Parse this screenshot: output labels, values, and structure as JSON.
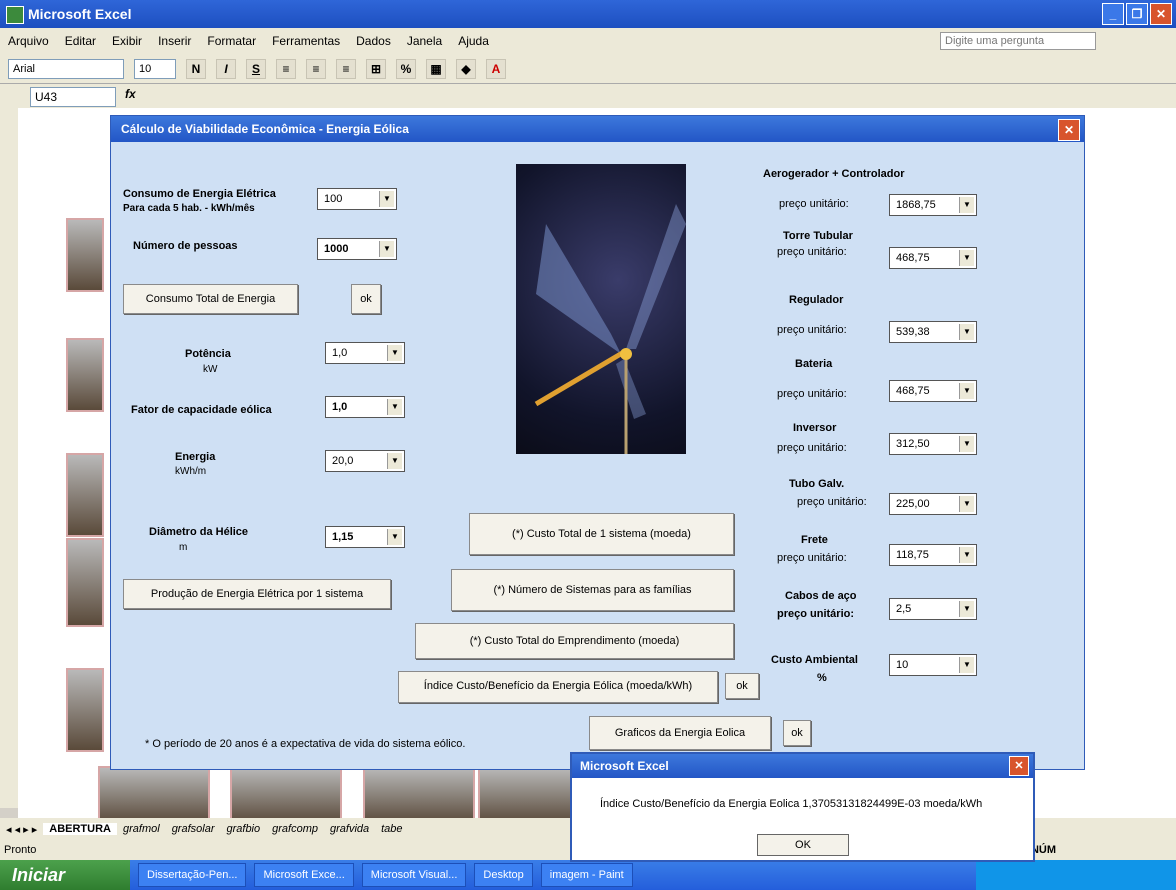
{
  "excel": {
    "title": "Microsoft Excel",
    "menu": [
      "Arquivo",
      "Editar",
      "Exibir",
      "Inserir",
      "Formatar",
      "Ferramentas",
      "Dados",
      "Janela",
      "Ajuda"
    ],
    "help_placeholder": "Digite uma pergunta",
    "font_name": "Arial",
    "font_size": "10",
    "name_box": "U43",
    "fx": "fx",
    "sheet_tabs": [
      "ABERTURA",
      "grafmol",
      "grafsolar",
      "grafbio",
      "grafcomp",
      "grafvida",
      "tabe"
    ],
    "status_left": "Pronto",
    "status_num": "NÚM"
  },
  "dialog": {
    "title": "Cálculo de Viabilidade Econômica - Energia Eólica",
    "consumo_label": "Consumo de Energia Elétrica",
    "consumo_sub": "Para cada 5 hab. -  kWh/mês",
    "consumo_value": "100",
    "pessoas_label": "Número de pessoas",
    "pessoas_value": "1000",
    "consumo_total_btn": "Consumo Total de Energia",
    "ok": "ok",
    "potencia_label": "Potência",
    "potencia_unit": "kW",
    "potencia_value": "1,0",
    "fator_label": "Fator de capacidade eólica",
    "fator_value": "1,0",
    "energia_label": "Energia",
    "energia_unit": "kWh/m",
    "energia_value": "20,0",
    "diametro_label": "Diâmetro da Hélice",
    "diametro_unit": "m",
    "diametro_value": "1,15",
    "producao_btn": "Produção de Energia Elétrica por 1 sistema",
    "custo_sistema_btn": "(*) Custo Total de 1 sistema (moeda)",
    "num_sistemas_btn": "(*) Número de Sistemas para as famílias",
    "custo_empreend_btn": "(*) Custo Total do Emprendimento (moeda)",
    "indice_btn": "Índice Custo/Benefício da Energia Eólica (moeda/kWh)",
    "graficos_btn": "Graficos da Energia Eolica",
    "footnote": "*  O período de 20 anos é a expectativa de vida do sistema eólico.",
    "preco_unitario": "preço unitário:",
    "right": [
      {
        "title": "Aerogerador + Controlador",
        "value": "1868,75"
      },
      {
        "title": "Torre Tubular",
        "value": "468,75"
      },
      {
        "title": "Regulador",
        "value": "539,38"
      },
      {
        "title": "Bateria",
        "value": "468,75"
      },
      {
        "title": "Inversor",
        "value": "312,50"
      },
      {
        "title": "Tubo Galv.",
        "value": "225,00"
      },
      {
        "title": "Frete",
        "value": "118,75"
      },
      {
        "title": "Cabos de aço",
        "value": "2,5"
      },
      {
        "title": "Custo Ambiental",
        "value": "10",
        "unit": "%"
      }
    ]
  },
  "msgbox": {
    "title": "Microsoft Excel",
    "text": "Índice Custo/Benefício da Energia Eolica  1,37053131824499E-03 moeda/kWh",
    "ok": "OK"
  },
  "taskbar": {
    "start": "Iniciar",
    "tasks": [
      "Dissertação-Pen...",
      "Microsoft Exce...",
      "Microsoft Visual...",
      "Desktop",
      "imagem - Paint"
    ]
  }
}
